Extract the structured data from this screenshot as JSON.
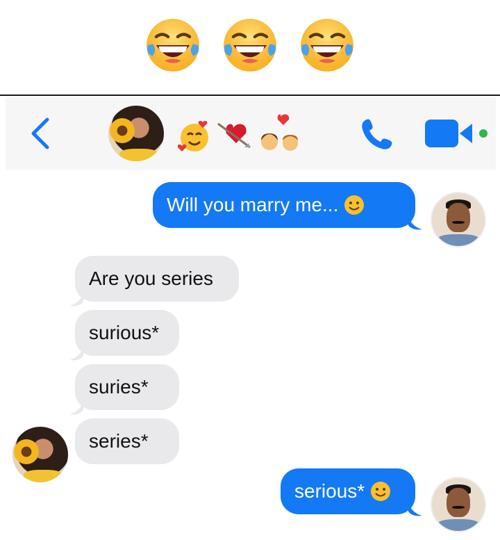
{
  "reaction_emojis": [
    "laughing-with-tears",
    "laughing-with-tears",
    "laughing-with-tears"
  ],
  "header": {
    "contact_avatar": "woman-with-sunflower-avatar",
    "emoji_status": [
      "smiling-face-with-hearts",
      "heart-with-arrow",
      "couple-with-heart"
    ],
    "actions": [
      "back-chevron",
      "phone-call",
      "video-call"
    ],
    "active_status_color": "#2db84d"
  },
  "messages": [
    {
      "side": "out",
      "text": "Will you marry me...",
      "emoji": "slightly-smiling-face"
    },
    {
      "side": "in",
      "text": "Are you series"
    },
    {
      "side": "in",
      "text": "surious*"
    },
    {
      "side": "in",
      "text": "suries*"
    },
    {
      "side": "in",
      "text": "series*"
    },
    {
      "side": "out",
      "text": "serious*",
      "emoji": "slightly-smiling-face"
    }
  ],
  "colors": {
    "outgoing_bubble": "#1479f5",
    "incoming_bubble": "#e9e9eb",
    "accent_blue": "#1479f5",
    "header_bg": "#f6f6f7"
  }
}
